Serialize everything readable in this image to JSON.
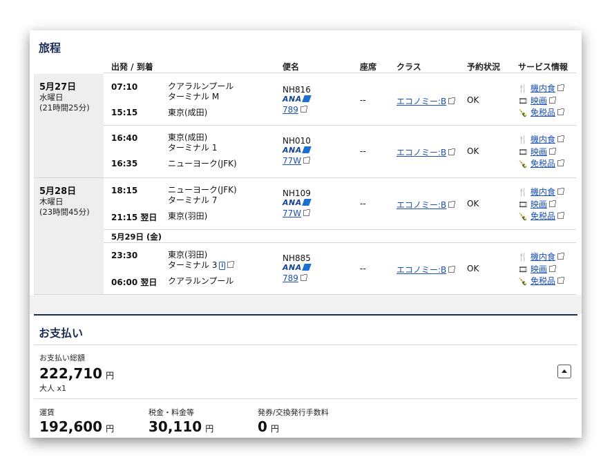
{
  "itinerary": {
    "title": "旅程",
    "headers": {
      "depart_arrive": "出発 / 到着",
      "flight": "便名",
      "seat": "座席",
      "class": "クラス",
      "status": "予約状況",
      "service": "サービス情報"
    },
    "days": [
      {
        "date": "5月27日",
        "weekday": "水曜日",
        "duration": "(21時間25分)"
      },
      {
        "date": "5月28日",
        "weekday": "木曜日",
        "duration": "(23時間45分)"
      }
    ],
    "date_separator": "5月29日 (金)",
    "segments": [
      {
        "dep_time": "07:10",
        "dep_city": "クアラルンプール",
        "dep_terminal": "ターミナル M",
        "arr_time": "15:15",
        "arr_city": "東京(成田)",
        "flight_no": "NH816",
        "airline": "ANA",
        "aircraft": "789",
        "seat": "--",
        "class_label": "エコノミー:B",
        "status": "OK"
      },
      {
        "dep_time": "16:40",
        "dep_city": "東京(成田)",
        "dep_terminal": "ターミナル 1",
        "arr_time": "16:35",
        "arr_city": "ニューヨーク(JFK)",
        "flight_no": "NH010",
        "airline": "ANA",
        "aircraft": "77W",
        "seat": "--",
        "class_label": "エコノミー:B",
        "status": "OK"
      },
      {
        "dep_time": "18:15",
        "dep_city": "ニューヨーク(JFK)",
        "dep_terminal": "ターミナル 7",
        "arr_time": "21:15 翌日",
        "arr_city": "東京(羽田)",
        "flight_no": "NH109",
        "airline": "ANA",
        "aircraft": "77W",
        "seat": "--",
        "class_label": "エコノミー:B",
        "status": "OK"
      },
      {
        "dep_time": "23:30",
        "dep_city": "東京(羽田)",
        "dep_terminal": "ターミナル 3",
        "arr_time": "06:00 翌日",
        "arr_city": "クアラルンプール",
        "flight_no": "NH885",
        "airline": "ANA",
        "aircraft": "789",
        "seat": "--",
        "class_label": "エコノミー:B",
        "status": "OK"
      }
    ],
    "services": {
      "meal": "機内食",
      "movie": "映画",
      "dutyfree": "免税品"
    },
    "terminal_note_icon": "i"
  },
  "payment": {
    "title": "お支払い",
    "total_label": "お支払い総額",
    "total_value": "222,710",
    "currency": "円",
    "pax": "大人 x1",
    "fare_label": "運賃",
    "fare_value": "192,600",
    "tax_label": "税金・料金等",
    "tax_value": "30,110",
    "fee_label": "発券/交換発行手数料",
    "fee_value": "0"
  },
  "icons": {
    "meal": "fork-knife-icon",
    "movie": "film-icon",
    "dutyfree": "bottle-icon",
    "external": "external-link-icon",
    "toggle": "caret-up-icon"
  },
  "colors": {
    "brand_navy": "#1a2b55",
    "link": "#1a4fb8",
    "ana_blue": "#13448f"
  }
}
